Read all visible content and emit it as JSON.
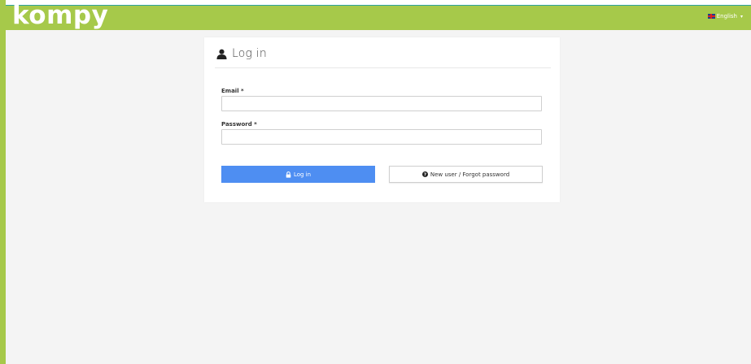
{
  "header": {
    "logo": "kompy",
    "language": "English",
    "language_icon": "uk-flag-icon",
    "caret": "▾"
  },
  "login": {
    "title": "Log in",
    "title_icon": "user-icon",
    "email_label": "Email *",
    "email_value": "",
    "password_label": "Password *",
    "password_value": "",
    "login_button": "Log in",
    "login_icon": "lock-icon",
    "new_user_button": "New user / Forgot password",
    "new_user_icon": "question-circle-icon"
  },
  "colors": {
    "brand_green": "#a6c94a",
    "primary_blue": "#4e8ef2",
    "background": "#f4f4f4"
  }
}
